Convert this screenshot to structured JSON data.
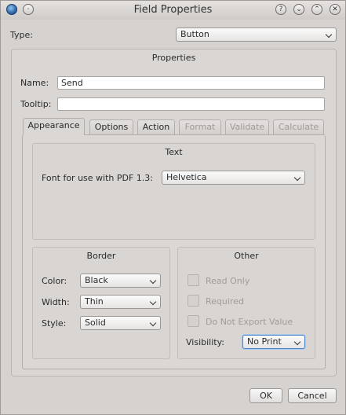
{
  "window": {
    "title": "Field Properties"
  },
  "titlebar_buttons": {
    "help": "?",
    "minimize": "⌄",
    "maximize": "⌃",
    "close": "✕"
  },
  "type": {
    "label": "Type:",
    "value": "Button"
  },
  "properties": {
    "title": "Properties",
    "name_label": "Name:",
    "name_value": "Send",
    "tooltip_label": "Tooltip:",
    "tooltip_value": ""
  },
  "tabs": [
    {
      "label": "Appearance",
      "state": "active"
    },
    {
      "label": "Options",
      "state": "normal"
    },
    {
      "label": "Action",
      "state": "normal"
    },
    {
      "label": "Format",
      "state": "disabled"
    },
    {
      "label": "Validate",
      "state": "disabled"
    },
    {
      "label": "Calculate",
      "state": "disabled"
    }
  ],
  "text_section": {
    "title": "Text",
    "font_label": "Font for use with PDF 1.3:",
    "font_value": "Helvetica"
  },
  "border_section": {
    "title": "Border",
    "color_label": "Color:",
    "color_value": "Black",
    "width_label": "Width:",
    "width_value": "Thin",
    "style_label": "Style:",
    "style_value": "Solid"
  },
  "other_section": {
    "title": "Other",
    "read_only": "Read Only",
    "required": "Required",
    "do_not_export": "Do Not Export Value",
    "visibility_label": "Visibility:",
    "visibility_value": "No Print"
  },
  "buttons": {
    "ok": "OK",
    "cancel": "Cancel"
  }
}
